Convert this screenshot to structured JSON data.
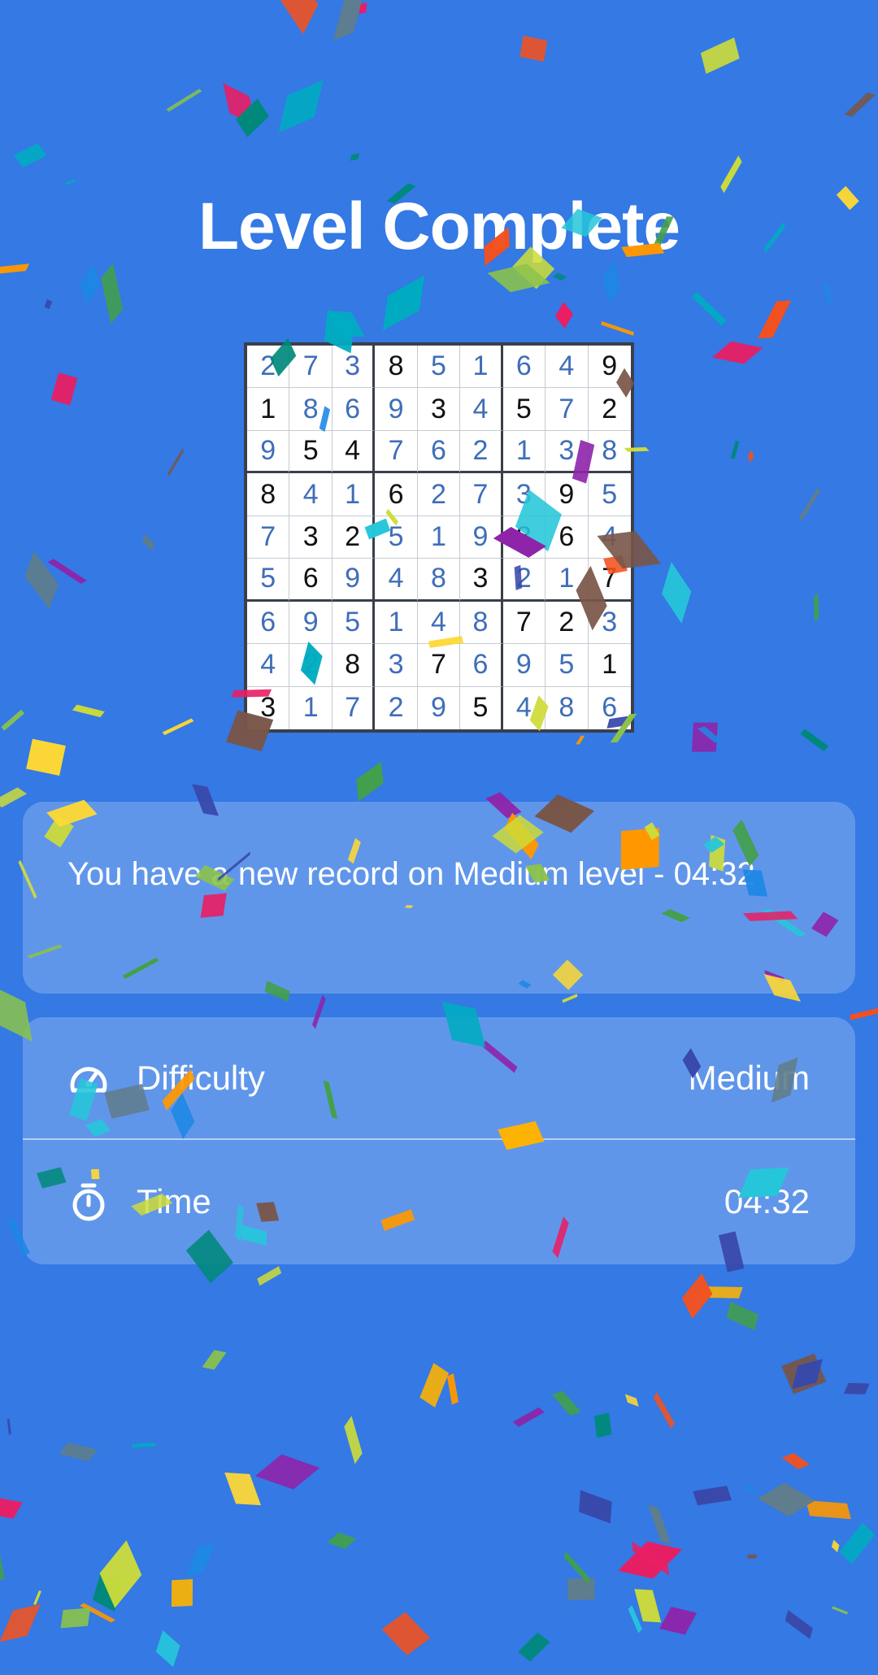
{
  "title": "Level Complete",
  "board": {
    "rows": [
      [
        "2",
        "7",
        "3",
        "8",
        "5",
        "1",
        "6",
        "4",
        "9"
      ],
      [
        "1",
        "8",
        "6",
        "9",
        "3",
        "4",
        "5",
        "7",
        "2"
      ],
      [
        "9",
        "5",
        "4",
        "7",
        "6",
        "2",
        "1",
        "3",
        "8"
      ],
      [
        "8",
        "4",
        "1",
        "6",
        "2",
        "7",
        "3",
        "9",
        "5"
      ],
      [
        "7",
        "3",
        "2",
        "5",
        "1",
        "9",
        "8",
        "6",
        "4"
      ],
      [
        "5",
        "6",
        "9",
        "4",
        "8",
        "3",
        "2",
        "1",
        "7"
      ],
      [
        "6",
        "9",
        "5",
        "1",
        "4",
        "8",
        "7",
        "2",
        "3"
      ],
      [
        "4",
        "2",
        "8",
        "3",
        "7",
        "6",
        "9",
        "5",
        "1"
      ],
      [
        "3",
        "1",
        "7",
        "2",
        "9",
        "5",
        "4",
        "8",
        "6"
      ]
    ],
    "given": [
      [
        0,
        0,
        0,
        1,
        0,
        0,
        0,
        0,
        1
      ],
      [
        1,
        0,
        0,
        0,
        1,
        0,
        1,
        0,
        1
      ],
      [
        0,
        1,
        1,
        0,
        0,
        0,
        0,
        0,
        0
      ],
      [
        1,
        0,
        0,
        1,
        0,
        0,
        0,
        1,
        0
      ],
      [
        0,
        1,
        1,
        0,
        0,
        0,
        1,
        1,
        0
      ],
      [
        0,
        1,
        0,
        0,
        0,
        1,
        0,
        0,
        1
      ],
      [
        0,
        0,
        0,
        0,
        0,
        0,
        1,
        1,
        0
      ],
      [
        0,
        0,
        1,
        0,
        1,
        0,
        0,
        0,
        1
      ],
      [
        1,
        0,
        0,
        0,
        0,
        1,
        0,
        0,
        0
      ]
    ],
    "colors": {
      "filled": "#3f6eb8",
      "given": "#111111",
      "background": "#ffffff"
    }
  },
  "record": {
    "message": "You have a new record on Medium level - 04:32"
  },
  "stats": {
    "difficulty": {
      "label": "Difficulty",
      "value": "Medium",
      "icon": "speedometer-icon"
    },
    "time": {
      "label": "Time",
      "value": "04:32",
      "icon": "stopwatch-icon"
    }
  },
  "theme": {
    "background": "#3479e4",
    "card": "rgba(255,255,255,0.22)"
  }
}
